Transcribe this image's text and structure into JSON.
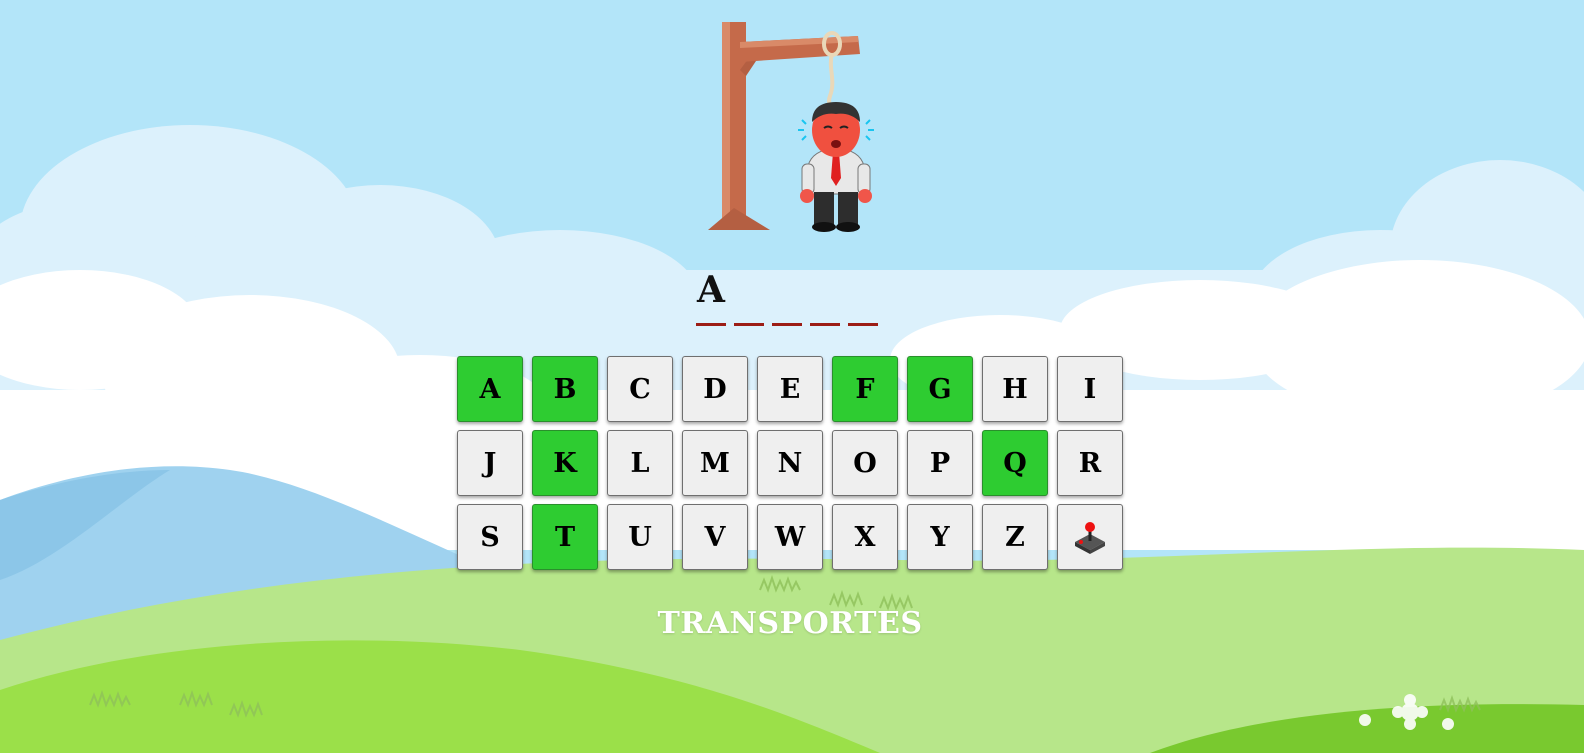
{
  "game": {
    "word_slots": [
      "A",
      "",
      "",
      "",
      ""
    ],
    "category": "TRANSPORTES"
  },
  "keyboard": {
    "keys": [
      {
        "label": "A",
        "used": true
      },
      {
        "label": "B",
        "used": true
      },
      {
        "label": "C",
        "used": false
      },
      {
        "label": "D",
        "used": false
      },
      {
        "label": "E",
        "used": false
      },
      {
        "label": "F",
        "used": true
      },
      {
        "label": "G",
        "used": true
      },
      {
        "label": "H",
        "used": false
      },
      {
        "label": "I",
        "used": false
      },
      {
        "label": "J",
        "used": false
      },
      {
        "label": "K",
        "used": true
      },
      {
        "label": "L",
        "used": false
      },
      {
        "label": "M",
        "used": false
      },
      {
        "label": "N",
        "used": false
      },
      {
        "label": "O",
        "used": false
      },
      {
        "label": "P",
        "used": false
      },
      {
        "label": "Q",
        "used": true
      },
      {
        "label": "R",
        "used": false
      },
      {
        "label": "S",
        "used": false
      },
      {
        "label": "T",
        "used": true
      },
      {
        "label": "U",
        "used": false
      },
      {
        "label": "V",
        "used": false
      },
      {
        "label": "W",
        "used": false
      },
      {
        "label": "X",
        "used": false
      },
      {
        "label": "Y",
        "used": false
      },
      {
        "label": "Z",
        "used": false
      }
    ],
    "reset_icon": "joystick-icon"
  },
  "colors": {
    "used_key": "#2ecc31",
    "key": "#efefef",
    "slot_line": "#9c1d15",
    "sky": "#b3e5f9",
    "grass": "#9be049"
  }
}
